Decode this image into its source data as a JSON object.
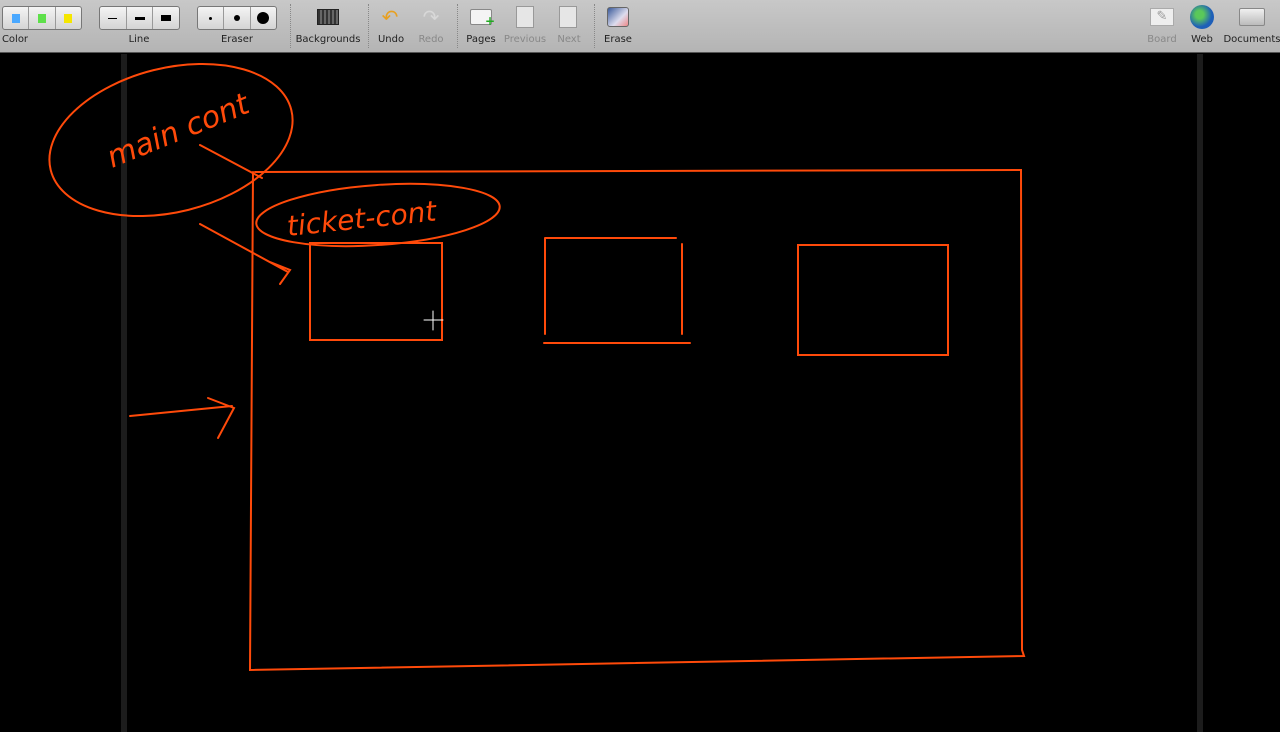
{
  "toolbar": {
    "color_label": "Color",
    "line_label": "Line",
    "eraser_label": "Eraser",
    "backgrounds_label": "Backgrounds",
    "undo_label": "Undo",
    "redo_label": "Redo",
    "pages_label": "Pages",
    "previous_label": "Previous",
    "next_label": "Next",
    "erase_label": "Erase",
    "board_label": "Board",
    "web_label": "Web",
    "documents_label": "Documents",
    "colors": [
      "#4aa8ff",
      "#5ee04a",
      "#f5e600"
    ]
  },
  "canvas": {
    "ink_color": "#ff4a0a",
    "main_note": "main cont",
    "ticket_note": "ticket-cont"
  }
}
